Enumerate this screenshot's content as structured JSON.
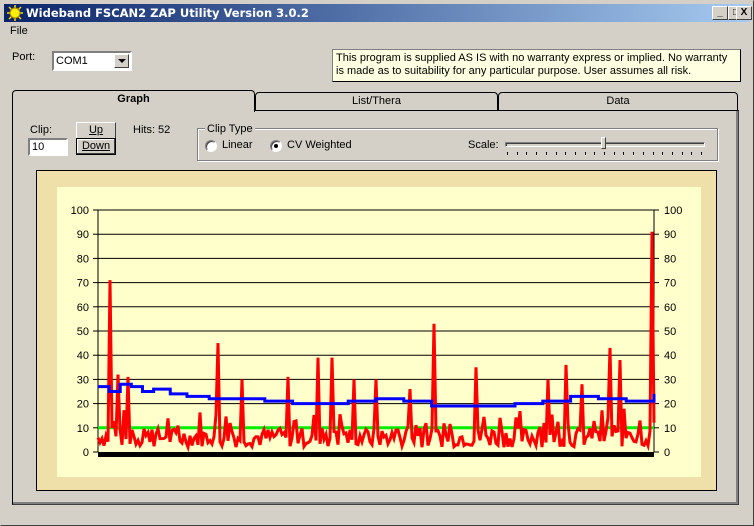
{
  "window": {
    "title": "Wideband FSCAN2 ZAP Utility Version 3.0.2",
    "controls": {
      "minimize": "_",
      "maximize": "□",
      "close": "X"
    }
  },
  "menu": {
    "items": [
      {
        "label": "File"
      }
    ]
  },
  "port": {
    "label": "Port:",
    "value": "COM1"
  },
  "disclaimer": "This program is supplied AS IS with no warranty express or implied. No warranty is made as to suitability for any particular purpose. User assumes all risk.",
  "tabs": [
    {
      "label": "Graph",
      "active": true
    },
    {
      "label": "List/Thera",
      "active": false
    },
    {
      "label": "Data",
      "active": false
    }
  ],
  "graph_tab": {
    "clip_label": "Clip:",
    "clip_value": "10",
    "up_button": "Up",
    "down_button": "Down",
    "hits_label": "Hits: 52",
    "clip_type": {
      "title": "Clip Type",
      "options": [
        {
          "label": "Linear",
          "checked": false
        },
        {
          "label": "CV Weighted",
          "checked": true
        }
      ]
    },
    "scale": {
      "label": "Scale:",
      "position_fraction": 0.5,
      "ticks": 21
    }
  },
  "colors": {
    "frame_bg": "#efdfa8",
    "plot_bg": "#ffffcc",
    "red_series": "#ff0000",
    "blue_series": "#0000ff",
    "green_series": "#00ee00",
    "axis": "#000000"
  },
  "chart_data": {
    "type": "line",
    "title": "",
    "xlabel": "",
    "ylabel": "",
    "ylim": [
      0,
      100
    ],
    "yticks": [
      "0",
      "10",
      "20",
      "30",
      "40",
      "50",
      "60",
      "70",
      "80",
      "90",
      "100"
    ],
    "grid": true,
    "dual_y_axis": true,
    "legend": "none",
    "series": [
      {
        "name": "clip-threshold",
        "color": "#00ee00",
        "values": [
          10,
          10
        ],
        "x": [
          0,
          1
        ]
      },
      {
        "name": "average",
        "color": "#0000ff",
        "x_fraction": [
          0,
          0.02,
          0.04,
          0.06,
          0.08,
          0.1,
          0.13,
          0.16,
          0.2,
          0.25,
          0.3,
          0.35,
          0.4,
          0.45,
          0.5,
          0.55,
          0.6,
          0.65,
          0.7,
          0.75,
          0.8,
          0.85,
          0.9,
          0.95,
          0.98,
          1
        ],
        "values": [
          27,
          25,
          28,
          27,
          25,
          26,
          24,
          23,
          22,
          22,
          21,
          20,
          20,
          21,
          22,
          21,
          19,
          19,
          19,
          20,
          21,
          23,
          22,
          21,
          21,
          24
        ]
      },
      {
        "name": "hits",
        "color": "#ff0000",
        "peaks": [
          {
            "x_fraction": 0.02,
            "value": 71
          },
          {
            "x_fraction": 0.035,
            "value": 32
          },
          {
            "x_fraction": 0.055,
            "value": 31
          },
          {
            "x_fraction": 0.215,
            "value": 45
          },
          {
            "x_fraction": 0.26,
            "value": 30
          },
          {
            "x_fraction": 0.34,
            "value": 31
          },
          {
            "x_fraction": 0.395,
            "value": 39
          },
          {
            "x_fraction": 0.42,
            "value": 39
          },
          {
            "x_fraction": 0.46,
            "value": 30
          },
          {
            "x_fraction": 0.5,
            "value": 30
          },
          {
            "x_fraction": 0.56,
            "value": 26
          },
          {
            "x_fraction": 0.605,
            "value": 53
          },
          {
            "x_fraction": 0.68,
            "value": 35
          },
          {
            "x_fraction": 0.81,
            "value": 30
          },
          {
            "x_fraction": 0.84,
            "value": 36
          },
          {
            "x_fraction": 0.87,
            "value": 28
          },
          {
            "x_fraction": 0.92,
            "value": 43
          },
          {
            "x_fraction": 0.94,
            "value": 38
          },
          {
            "x_fraction": 0.995,
            "value": 91
          }
        ],
        "baseline_range": [
          2,
          18
        ]
      }
    ]
  }
}
